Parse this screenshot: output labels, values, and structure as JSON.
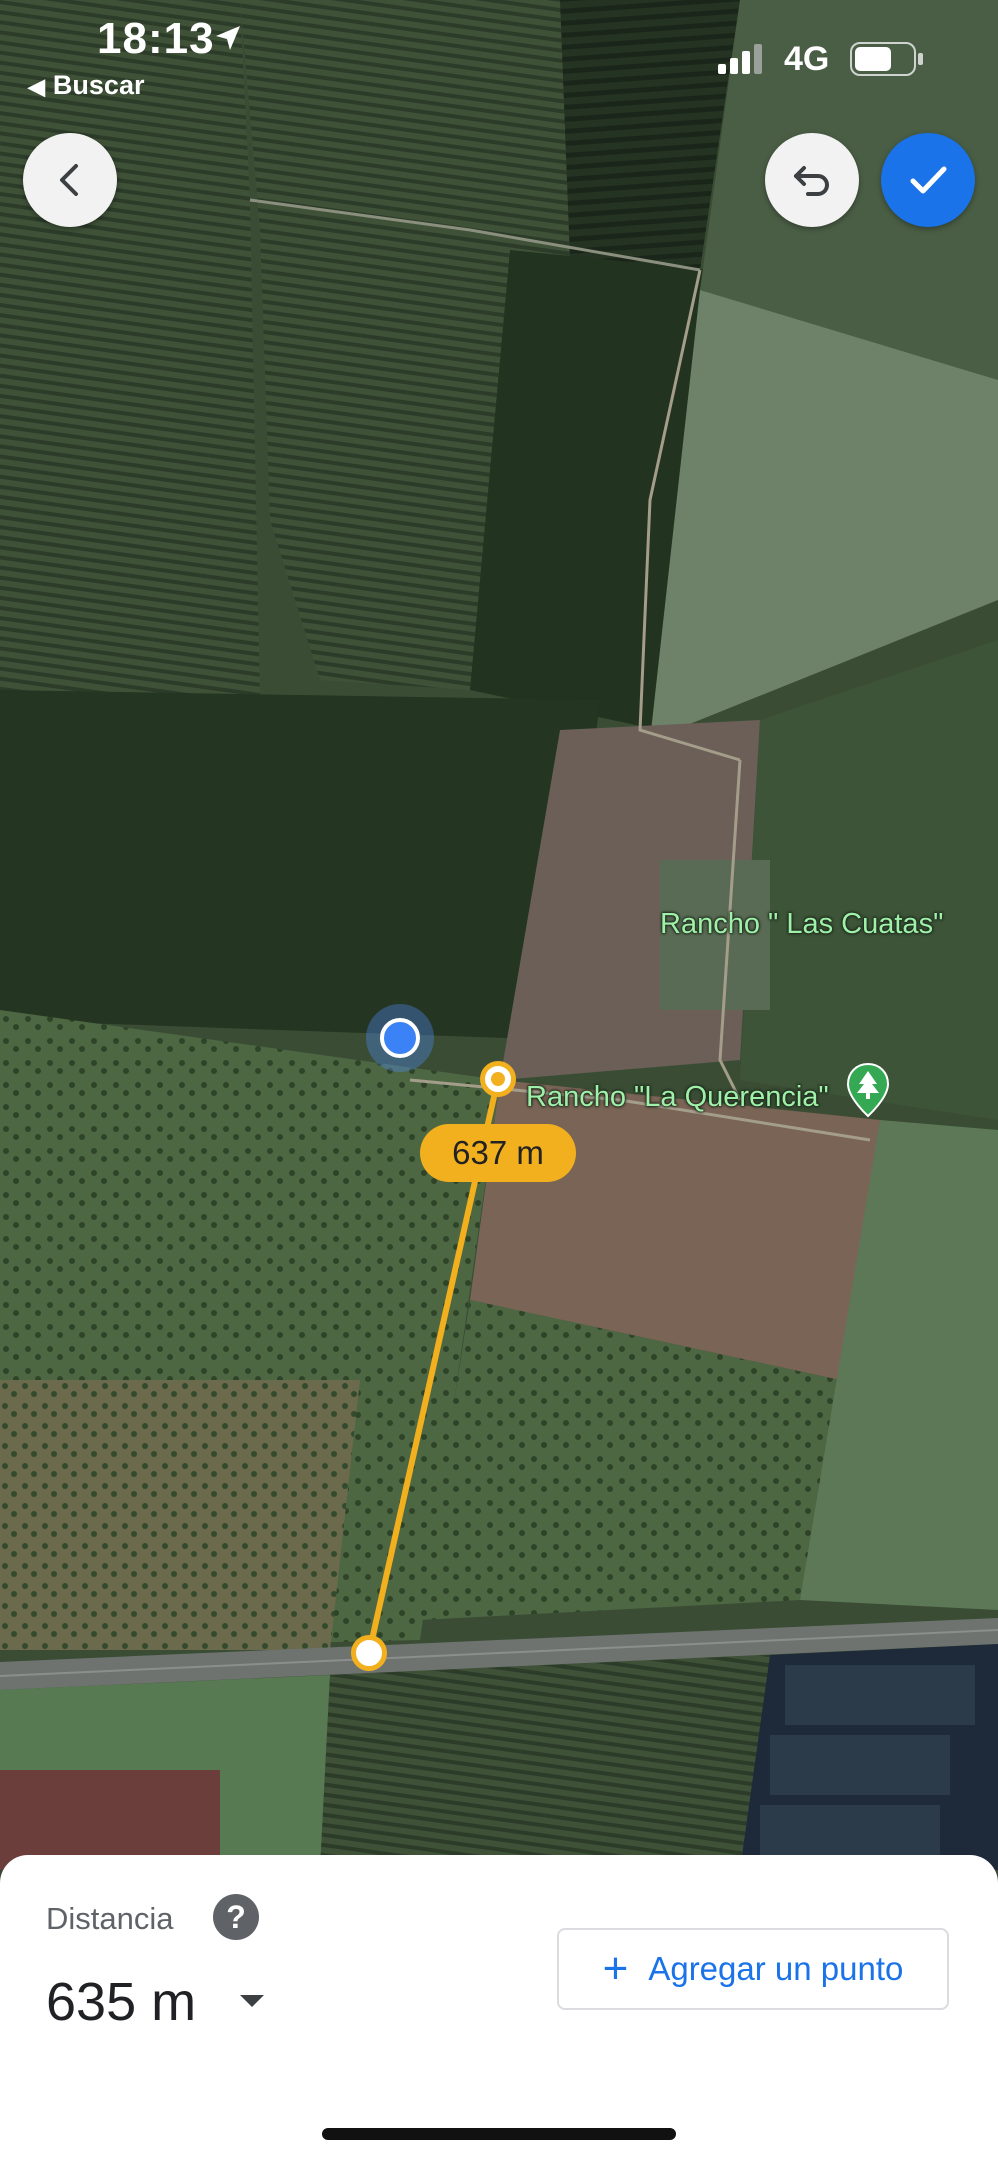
{
  "status_bar": {
    "time": "18:13",
    "back_app": "Buscar",
    "network": "4G"
  },
  "map": {
    "labels": {
      "place_1": "Rancho \" Las Cuatas\"",
      "place_2": "Rancho \"La Querencia\""
    },
    "segment_distance": "637 m",
    "colors": {
      "measure_line": "#f2b01e",
      "location_dot": "#3b82f6"
    }
  },
  "controls": {
    "back_icon": "chevron-left-icon",
    "undo_icon": "undo-icon",
    "done_icon": "check-icon"
  },
  "bottom_sheet": {
    "label": "Distancia",
    "help_glyph": "?",
    "value": "635 m",
    "add_point_button": "Agregar un punto",
    "add_point_plus": "+"
  }
}
